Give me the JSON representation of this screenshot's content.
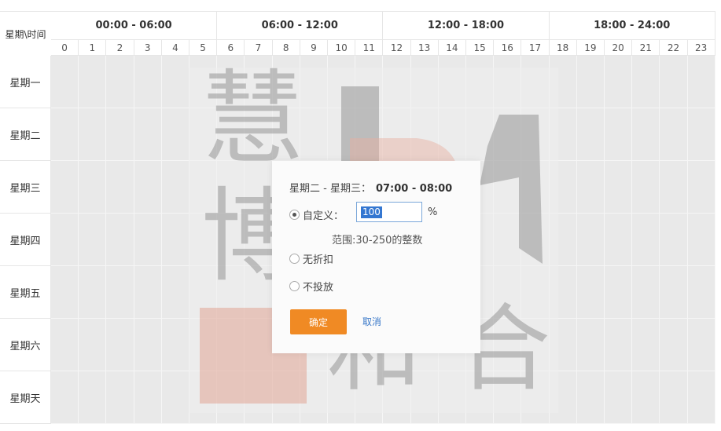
{
  "corner_label": "星期\\时间",
  "periods": [
    "00:00 - 06:00",
    "06:00 - 12:00",
    "12:00 - 18:00",
    "18:00 - 24:00"
  ],
  "hours": [
    "0",
    "1",
    "2",
    "3",
    "4",
    "5",
    "6",
    "7",
    "8",
    "9",
    "10",
    "11",
    "12",
    "13",
    "14",
    "15",
    "16",
    "17",
    "18",
    "19",
    "20",
    "21",
    "22",
    "23"
  ],
  "days": [
    "星期一",
    "星期二",
    "星期三",
    "星期四",
    "星期五",
    "星期六",
    "星期天"
  ],
  "watermark": {
    "chars": [
      "慧",
      "博",
      "和",
      "合"
    ],
    "logo_text": "B",
    "accent_color": "#e8b0a0"
  },
  "dialog": {
    "range_label": "星期二 - 星期三：",
    "time_range": "07:00 - 08:00",
    "custom_label": "自定义：",
    "custom_value": "100",
    "percent_sign": "%",
    "range_hint": "范围:30-250的整数",
    "no_discount_label": "无折扣",
    "no_delivery_label": "不投放",
    "confirm_label": "确定",
    "cancel_label": "取消",
    "selected_option": "custom"
  },
  "colors": {
    "confirm": "#f08a24",
    "cancel_link": "#3a78c8",
    "cell": "#e9e9e9"
  }
}
